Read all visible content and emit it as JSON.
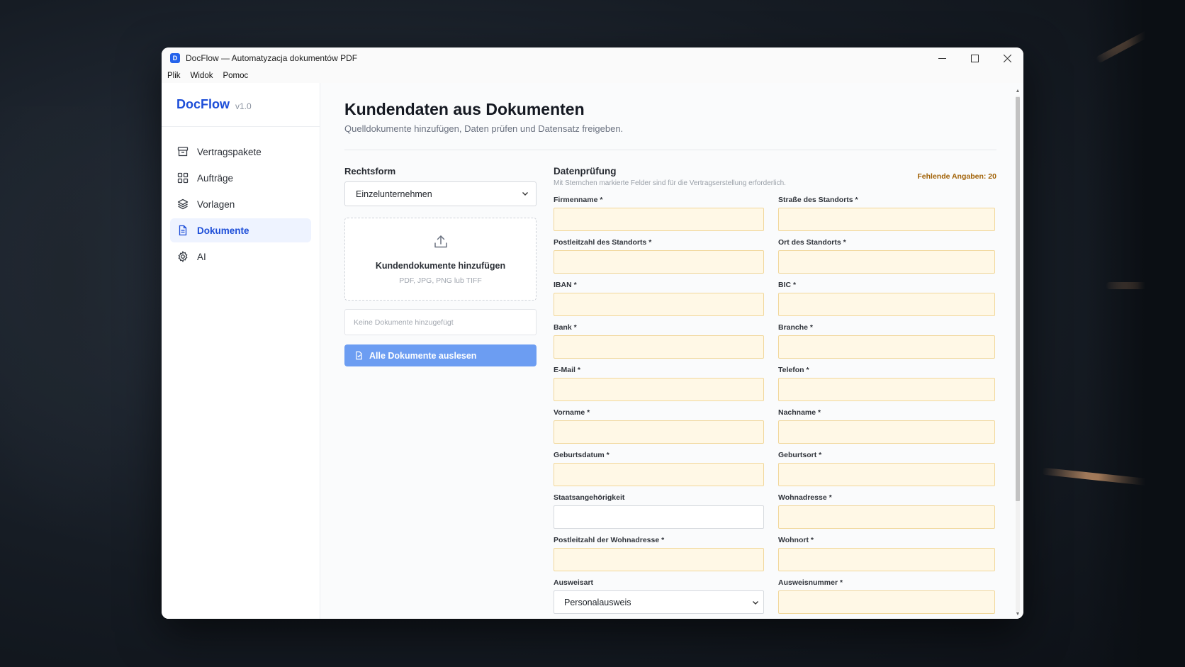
{
  "window": {
    "app_icon": "D",
    "title": "DocFlow — Automatyzacja dokumentów PDF",
    "controls": [
      "minimize-icon",
      "maximize-icon",
      "close-icon"
    ]
  },
  "menu": [
    "Plik",
    "Widok",
    "Pomoc"
  ],
  "brand": {
    "name": "DocFlow",
    "version": "v1.0",
    "accent": "#1d4ed8"
  },
  "sidebar": {
    "items": [
      {
        "label": "Vertragspakete",
        "icon": "archive-icon",
        "active": false
      },
      {
        "label": "Aufträge",
        "icon": "grid-icon",
        "active": false
      },
      {
        "label": "Vorlagen",
        "icon": "layers-icon",
        "active": false
      },
      {
        "label": "Dokumente",
        "icon": "document-icon",
        "active": true
      },
      {
        "label": "AI",
        "icon": "gear-icon",
        "active": false
      }
    ]
  },
  "page": {
    "title": "Kundendaten aus Dokumenten",
    "subtitle": "Quelldokumente hinzufügen, Daten prüfen und Datensatz freigeben."
  },
  "upload": {
    "rechtsform_label": "Rechtsform",
    "rechtsform_value": "Einzelunternehmen",
    "dropzone_title": "Kundendokumente hinzufügen",
    "dropzone_formats": "PDF, JPG, PNG lub TIFF",
    "docs_empty": "Keine Dokumente hinzugefügt",
    "read_all_button": "Alle Dokumente auslesen"
  },
  "datenpruefung": {
    "title": "Datenprüfung",
    "hint": "Mit Sternchen markierte Felder sind für die Vertragserstellung erforderlich.",
    "missing": "Fehlende Angaben: 20",
    "missing_color": "#a16207",
    "required_fill_color": "#fff8e6",
    "fields": [
      {
        "label": "Firmenname *",
        "value": "",
        "missing": true
      },
      {
        "label": "Straße des Standorts *",
        "value": "",
        "missing": true
      },
      {
        "label": "Postleitzahl des Standorts *",
        "value": "",
        "missing": true
      },
      {
        "label": "Ort des Standorts *",
        "value": "",
        "missing": true
      },
      {
        "label": "IBAN *",
        "value": "",
        "missing": true
      },
      {
        "label": "BIC *",
        "value": "",
        "missing": true
      },
      {
        "label": "Bank *",
        "value": "",
        "missing": true
      },
      {
        "label": "Branche *",
        "value": "",
        "missing": true
      },
      {
        "label": "E-Mail *",
        "value": "",
        "missing": true
      },
      {
        "label": "Telefon *",
        "value": "",
        "missing": true
      },
      {
        "label": "Vorname *",
        "value": "",
        "missing": true
      },
      {
        "label": "Nachname *",
        "value": "",
        "missing": true
      },
      {
        "label": "Geburtsdatum *",
        "value": "",
        "missing": true
      },
      {
        "label": "Geburtsort *",
        "value": "",
        "missing": true
      },
      {
        "label": "Staatsangehörigkeit",
        "value": "",
        "missing": false
      },
      {
        "label": "Wohnadresse *",
        "value": "",
        "missing": true
      },
      {
        "label": "Postleitzahl der Wohnadresse *",
        "value": "",
        "missing": true
      },
      {
        "label": "Wohnort *",
        "value": "",
        "missing": true
      },
      {
        "label": "Ausweisart",
        "value": "Personalausweis",
        "missing": false,
        "type": "select"
      },
      {
        "label": "Ausweisnummer *",
        "value": "",
        "missing": true
      }
    ]
  }
}
